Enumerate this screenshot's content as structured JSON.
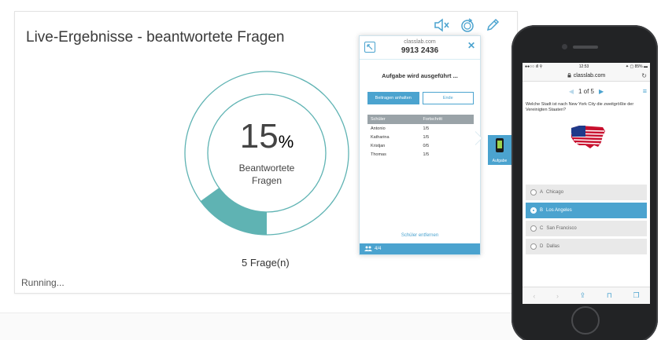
{
  "results": {
    "title": "Live-Ergebnisse - beantwortete Fragen",
    "percent_value": "15",
    "percent_sign": "%",
    "percent_fraction": 0.15,
    "percent_label": "Beantwortete Fragen",
    "question_count": "5 Frage(n)",
    "status": "Running...",
    "accent_color": "#5fb3b3"
  },
  "toolbar": {
    "icons": [
      "mute-icon",
      "refresh-icon",
      "edit-pencil-icon"
    ]
  },
  "popup": {
    "domain": "classlab.com",
    "code": "9913 2436",
    "task_status": "Aufgabe wird ausgeführt ...",
    "stop_button": "Beitragen anhalten",
    "end_button": "Ende",
    "table_headers": [
      "Schüler",
      "Fortschritt"
    ],
    "students": [
      {
        "name": "Antonio",
        "progress": "1/5"
      },
      {
        "name": "Katharina",
        "progress": "1/5"
      },
      {
        "name": "Kristjan",
        "progress": "0/5"
      },
      {
        "name": "Thomas",
        "progress": "1/5"
      }
    ],
    "remove_students": "Schüler entfernen",
    "footer_count": "4/4",
    "accent_color": "#4ba3cf"
  },
  "badge": {
    "label": "Aufgabe"
  },
  "phone": {
    "status_left": "●●○○ ıll ⚲",
    "status_time": "12:53",
    "status_right": "✦ ▢ 85% ▬",
    "url": "classlab.com",
    "pager": "1 of 5",
    "question": "Welche Stadt ist nach New York City die zweitgrößte der Vereinigten Staaten?",
    "options": [
      {
        "letter": "A",
        "text": "Chicago",
        "selected": false
      },
      {
        "letter": "B",
        "text": "Los Angeles",
        "selected": true
      },
      {
        "letter": "C",
        "text": "San Francisco",
        "selected": false
      },
      {
        "letter": "D",
        "text": "Dallas",
        "selected": false
      }
    ]
  }
}
